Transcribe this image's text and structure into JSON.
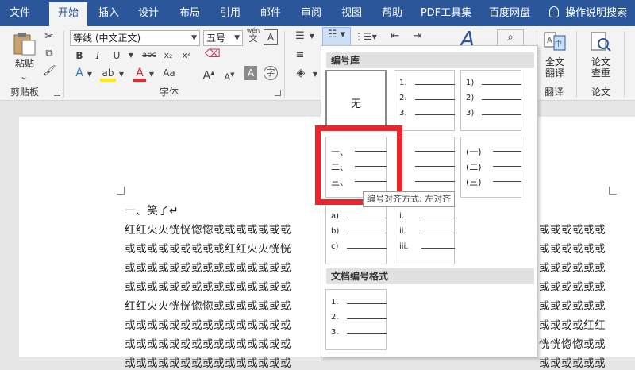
{
  "tabs": [
    {
      "label": "文件",
      "active": false
    },
    {
      "label": "开始",
      "active": true
    },
    {
      "label": "插入",
      "active": false
    },
    {
      "label": "设计",
      "active": false
    },
    {
      "label": "布局",
      "active": false
    },
    {
      "label": "引用",
      "active": false
    },
    {
      "label": "邮件",
      "active": false
    },
    {
      "label": "审阅",
      "active": false
    },
    {
      "label": "视图",
      "active": false
    },
    {
      "label": "帮助",
      "active": false
    },
    {
      "label": "PDF工具集",
      "active": false
    },
    {
      "label": "百度网盘",
      "active": false
    }
  ],
  "tell_me": "操作说明搜索",
  "ribbon": {
    "paste_label": "粘贴",
    "clipboard_label": "剪贴板",
    "font_label": "字体",
    "font_name": "等线 (中文正文)",
    "font_size": "五号",
    "wen_label": "wén",
    "wen_char": "文",
    "bold": "B",
    "italic": "I",
    "underline": "U",
    "strike": "abc",
    "sub": "x₂",
    "sup": "x²",
    "grow": "A",
    "shrink": "A",
    "aa": "Aa",
    "fulltext_translate": [
      "全文",
      "翻译"
    ],
    "translate_label": "翻译",
    "paper_check": [
      "论文",
      "查重"
    ],
    "paper_label": "论文",
    "style_a": "A"
  },
  "document": {
    "heading": "一、笑了↵",
    "lines_left": [
      "红红火火恍恍惚惚或或或或或或或",
      "或或或或或或或或或红红火火恍恍",
      "或或或或或或或或或或或或或或或",
      "或或或或或或或或或或或或或或或",
      "红红火火恍恍惚惚或或或或或或或",
      "或或或或或或或或或或或或或或或",
      "或或或或或或或或或或或或或或或",
      "或或或或或或或或或或或或或或或"
    ],
    "lines_right": [
      "或或或或或或",
      "或或或或或或",
      "或或或或或或",
      "或或或或或或",
      "或或或或或或",
      "或或或或红红",
      "恍恍惚惚或或",
      "或或或或或或"
    ]
  },
  "dropdown": {
    "section_library": "编号库",
    "section_doc": "文档编号格式",
    "none_label": "无",
    "formats": [
      {
        "labels": [
          "1.",
          "2.",
          "3."
        ]
      },
      {
        "labels": [
          "1)",
          "2)",
          "3)"
        ]
      },
      {
        "labels": [
          "一、",
          "二、",
          "三、"
        ]
      },
      {
        "labels": [
          "",
          "",
          ""
        ]
      },
      {
        "labels": [
          "(一)",
          "(二)",
          "(三)"
        ]
      },
      {
        "labels": [
          "a)",
          "b)",
          "c)"
        ]
      },
      {
        "labels": [
          "i.",
          "ii.",
          "iii."
        ]
      },
      {
        "labels": [
          "1.",
          "2.",
          "3."
        ]
      }
    ],
    "tooltip": "编号对齐方式: 左对齐"
  },
  "colors": {
    "brand": "#2b579a",
    "highlight": "#e8262c"
  }
}
